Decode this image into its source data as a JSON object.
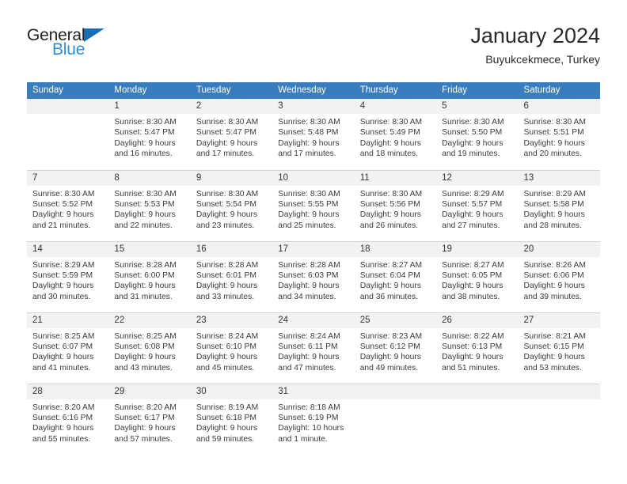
{
  "brand": {
    "name_top": "General",
    "name_bottom": "Blue",
    "triangle_color": "#1a6db5",
    "text_color": "#231f20",
    "accent_color": "#2e8fd9"
  },
  "header": {
    "title": "January 2024",
    "subtitle": "Buyukcekmece, Turkey"
  },
  "theme": {
    "header_bg": "#3a7dbf",
    "header_text": "#ffffff",
    "daynum_bg": "#f2f2f2",
    "cell_bg": "#ffffff",
    "grid_line": "#d4d4d4",
    "body_text": "#3b3b3b"
  },
  "columns": [
    "Sunday",
    "Monday",
    "Tuesday",
    "Wednesday",
    "Thursday",
    "Friday",
    "Saturday"
  ],
  "weeks": [
    [
      {
        "day": "",
        "blank": true,
        "sunrise": "",
        "sunset": "",
        "daylight_1": "",
        "daylight_2": ""
      },
      {
        "day": "1",
        "sunrise": "Sunrise: 8:30 AM",
        "sunset": "Sunset: 5:47 PM",
        "daylight_1": "Daylight: 9 hours",
        "daylight_2": "and 16 minutes."
      },
      {
        "day": "2",
        "sunrise": "Sunrise: 8:30 AM",
        "sunset": "Sunset: 5:47 PM",
        "daylight_1": "Daylight: 9 hours",
        "daylight_2": "and 17 minutes."
      },
      {
        "day": "3",
        "sunrise": "Sunrise: 8:30 AM",
        "sunset": "Sunset: 5:48 PM",
        "daylight_1": "Daylight: 9 hours",
        "daylight_2": "and 17 minutes."
      },
      {
        "day": "4",
        "sunrise": "Sunrise: 8:30 AM",
        "sunset": "Sunset: 5:49 PM",
        "daylight_1": "Daylight: 9 hours",
        "daylight_2": "and 18 minutes."
      },
      {
        "day": "5",
        "sunrise": "Sunrise: 8:30 AM",
        "sunset": "Sunset: 5:50 PM",
        "daylight_1": "Daylight: 9 hours",
        "daylight_2": "and 19 minutes."
      },
      {
        "day": "6",
        "sunrise": "Sunrise: 8:30 AM",
        "sunset": "Sunset: 5:51 PM",
        "daylight_1": "Daylight: 9 hours",
        "daylight_2": "and 20 minutes."
      }
    ],
    [
      {
        "day": "7",
        "sunrise": "Sunrise: 8:30 AM",
        "sunset": "Sunset: 5:52 PM",
        "daylight_1": "Daylight: 9 hours",
        "daylight_2": "and 21 minutes."
      },
      {
        "day": "8",
        "sunrise": "Sunrise: 8:30 AM",
        "sunset": "Sunset: 5:53 PM",
        "daylight_1": "Daylight: 9 hours",
        "daylight_2": "and 22 minutes."
      },
      {
        "day": "9",
        "sunrise": "Sunrise: 8:30 AM",
        "sunset": "Sunset: 5:54 PM",
        "daylight_1": "Daylight: 9 hours",
        "daylight_2": "and 23 minutes."
      },
      {
        "day": "10",
        "sunrise": "Sunrise: 8:30 AM",
        "sunset": "Sunset: 5:55 PM",
        "daylight_1": "Daylight: 9 hours",
        "daylight_2": "and 25 minutes."
      },
      {
        "day": "11",
        "sunrise": "Sunrise: 8:30 AM",
        "sunset": "Sunset: 5:56 PM",
        "daylight_1": "Daylight: 9 hours",
        "daylight_2": "and 26 minutes."
      },
      {
        "day": "12",
        "sunrise": "Sunrise: 8:29 AM",
        "sunset": "Sunset: 5:57 PM",
        "daylight_1": "Daylight: 9 hours",
        "daylight_2": "and 27 minutes."
      },
      {
        "day": "13",
        "sunrise": "Sunrise: 8:29 AM",
        "sunset": "Sunset: 5:58 PM",
        "daylight_1": "Daylight: 9 hours",
        "daylight_2": "and 28 minutes."
      }
    ],
    [
      {
        "day": "14",
        "sunrise": "Sunrise: 8:29 AM",
        "sunset": "Sunset: 5:59 PM",
        "daylight_1": "Daylight: 9 hours",
        "daylight_2": "and 30 minutes."
      },
      {
        "day": "15",
        "sunrise": "Sunrise: 8:28 AM",
        "sunset": "Sunset: 6:00 PM",
        "daylight_1": "Daylight: 9 hours",
        "daylight_2": "and 31 minutes."
      },
      {
        "day": "16",
        "sunrise": "Sunrise: 8:28 AM",
        "sunset": "Sunset: 6:01 PM",
        "daylight_1": "Daylight: 9 hours",
        "daylight_2": "and 33 minutes."
      },
      {
        "day": "17",
        "sunrise": "Sunrise: 8:28 AM",
        "sunset": "Sunset: 6:03 PM",
        "daylight_1": "Daylight: 9 hours",
        "daylight_2": "and 34 minutes."
      },
      {
        "day": "18",
        "sunrise": "Sunrise: 8:27 AM",
        "sunset": "Sunset: 6:04 PM",
        "daylight_1": "Daylight: 9 hours",
        "daylight_2": "and 36 minutes."
      },
      {
        "day": "19",
        "sunrise": "Sunrise: 8:27 AM",
        "sunset": "Sunset: 6:05 PM",
        "daylight_1": "Daylight: 9 hours",
        "daylight_2": "and 38 minutes."
      },
      {
        "day": "20",
        "sunrise": "Sunrise: 8:26 AM",
        "sunset": "Sunset: 6:06 PM",
        "daylight_1": "Daylight: 9 hours",
        "daylight_2": "and 39 minutes."
      }
    ],
    [
      {
        "day": "21",
        "sunrise": "Sunrise: 8:25 AM",
        "sunset": "Sunset: 6:07 PM",
        "daylight_1": "Daylight: 9 hours",
        "daylight_2": "and 41 minutes."
      },
      {
        "day": "22",
        "sunrise": "Sunrise: 8:25 AM",
        "sunset": "Sunset: 6:08 PM",
        "daylight_1": "Daylight: 9 hours",
        "daylight_2": "and 43 minutes."
      },
      {
        "day": "23",
        "sunrise": "Sunrise: 8:24 AM",
        "sunset": "Sunset: 6:10 PM",
        "daylight_1": "Daylight: 9 hours",
        "daylight_2": "and 45 minutes."
      },
      {
        "day": "24",
        "sunrise": "Sunrise: 8:24 AM",
        "sunset": "Sunset: 6:11 PM",
        "daylight_1": "Daylight: 9 hours",
        "daylight_2": "and 47 minutes."
      },
      {
        "day": "25",
        "sunrise": "Sunrise: 8:23 AM",
        "sunset": "Sunset: 6:12 PM",
        "daylight_1": "Daylight: 9 hours",
        "daylight_2": "and 49 minutes."
      },
      {
        "day": "26",
        "sunrise": "Sunrise: 8:22 AM",
        "sunset": "Sunset: 6:13 PM",
        "daylight_1": "Daylight: 9 hours",
        "daylight_2": "and 51 minutes."
      },
      {
        "day": "27",
        "sunrise": "Sunrise: 8:21 AM",
        "sunset": "Sunset: 6:15 PM",
        "daylight_1": "Daylight: 9 hours",
        "daylight_2": "and 53 minutes."
      }
    ],
    [
      {
        "day": "28",
        "sunrise": "Sunrise: 8:20 AM",
        "sunset": "Sunset: 6:16 PM",
        "daylight_1": "Daylight: 9 hours",
        "daylight_2": "and 55 minutes."
      },
      {
        "day": "29",
        "sunrise": "Sunrise: 8:20 AM",
        "sunset": "Sunset: 6:17 PM",
        "daylight_1": "Daylight: 9 hours",
        "daylight_2": "and 57 minutes."
      },
      {
        "day": "30",
        "sunrise": "Sunrise: 8:19 AM",
        "sunset": "Sunset: 6:18 PM",
        "daylight_1": "Daylight: 9 hours",
        "daylight_2": "and 59 minutes."
      },
      {
        "day": "31",
        "sunrise": "Sunrise: 8:18 AM",
        "sunset": "Sunset: 6:19 PM",
        "daylight_1": "Daylight: 10 hours",
        "daylight_2": "and 1 minute."
      },
      {
        "day": "",
        "blank": true,
        "sunrise": "",
        "sunset": "",
        "daylight_1": "",
        "daylight_2": ""
      },
      {
        "day": "",
        "blank": true,
        "sunrise": "",
        "sunset": "",
        "daylight_1": "",
        "daylight_2": ""
      },
      {
        "day": "",
        "blank": true,
        "sunrise": "",
        "sunset": "",
        "daylight_1": "",
        "daylight_2": ""
      }
    ]
  ]
}
